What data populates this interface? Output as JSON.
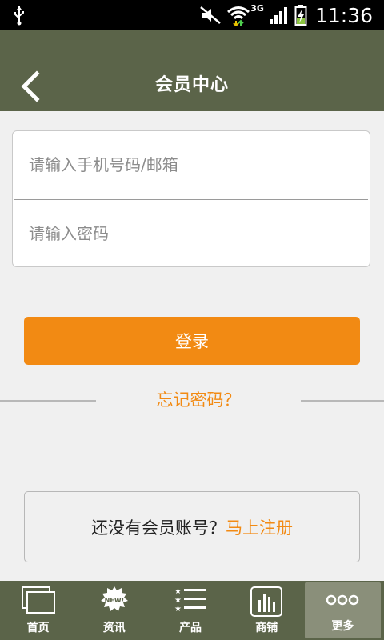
{
  "status_bar": {
    "time": "11:36",
    "network": "3G"
  },
  "header": {
    "title": "会员中心"
  },
  "login": {
    "phone_placeholder": "请输入手机号码/邮箱",
    "password_placeholder": "请输入密码",
    "login_button": "登录",
    "forgot_password": "忘记密码？"
  },
  "register": {
    "prompt": "还没有会员账号？",
    "link": "马上注册"
  },
  "bottom_nav": {
    "items": [
      {
        "label": "首页",
        "icon": "home-icon"
      },
      {
        "label": "资讯",
        "icon": "news-icon",
        "badge": "NEW!"
      },
      {
        "label": "产品",
        "icon": "products-icon"
      },
      {
        "label": "商铺",
        "icon": "store-icon"
      },
      {
        "label": "更多",
        "icon": "more-icon",
        "active": true
      }
    ]
  },
  "colors": {
    "header_bg": "#5b6449",
    "accent": "#f28a13",
    "page_bg": "#f0f0f0"
  }
}
